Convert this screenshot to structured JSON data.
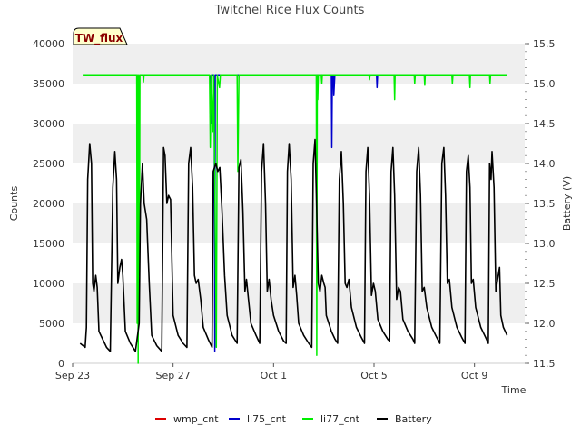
{
  "chart_data": {
    "type": "line",
    "title": "Twitchel Rice Flux Counts",
    "badge": "TW_flux",
    "xlabel": "Time",
    "ylabel": "Counts",
    "y2label": "Battery (V)",
    "xlim": [
      0,
      18
    ],
    "ylim": [
      0,
      40000
    ],
    "y2lim": [
      11.5,
      15.5
    ],
    "x_ticks": [
      {
        "x": 0,
        "label": "Sep 23"
      },
      {
        "x": 4,
        "label": "Sep 27"
      },
      {
        "x": 8,
        "label": "Oct 1"
      },
      {
        "x": 12,
        "label": "Oct 5"
      },
      {
        "x": 16,
        "label": "Oct 9"
      }
    ],
    "y_ticks": [
      0,
      5000,
      10000,
      15000,
      20000,
      25000,
      30000,
      35000,
      40000
    ],
    "y2_ticks": [
      "11.5",
      "12.0",
      "12.5",
      "13.0",
      "13.5",
      "14.0",
      "14.5",
      "15.0",
      "15.5"
    ],
    "grid": "horizontal bands",
    "legend_position": "bottom",
    "series": [
      {
        "name": "wmp_cnt",
        "axis": "left",
        "color": "#dd0000",
        "points": []
      },
      {
        "name": "li75_cnt",
        "axis": "left",
        "color": "#0000cc",
        "points": [
          [
            5.5,
            36000
          ],
          [
            5.52,
            30000
          ],
          [
            5.54,
            36000
          ],
          [
            5.62,
            36000
          ],
          [
            5.64,
            32500
          ],
          [
            5.66,
            1500
          ],
          [
            5.68,
            36000
          ],
          [
            10.3,
            36000
          ],
          [
            10.32,
            27000
          ],
          [
            10.34,
            36000
          ],
          [
            10.38,
            36000
          ],
          [
            10.4,
            33500
          ],
          [
            10.44,
            36000
          ],
          [
            12.1,
            36000
          ],
          [
            12.12,
            34500
          ],
          [
            12.14,
            36000
          ],
          [
            17.3,
            36000
          ]
        ]
      },
      {
        "name": "li77_cnt",
        "axis": "left",
        "color": "#00ee00",
        "points": [
          [
            0.4,
            36000
          ],
          [
            2.55,
            36000
          ],
          [
            2.57,
            5000
          ],
          [
            2.59,
            36000
          ],
          [
            2.61,
            0
          ],
          [
            2.63,
            36000
          ],
          [
            2.66,
            11000
          ],
          [
            2.68,
            36000
          ],
          [
            2.8,
            36000
          ],
          [
            2.82,
            35200
          ],
          [
            2.84,
            36000
          ],
          [
            5.45,
            36000
          ],
          [
            5.48,
            27000
          ],
          [
            5.52,
            36000
          ],
          [
            5.58,
            29000
          ],
          [
            5.62,
            36000
          ],
          [
            5.72,
            2000
          ],
          [
            5.76,
            36000
          ],
          [
            5.85,
            34500
          ],
          [
            5.88,
            36000
          ],
          [
            6.55,
            36000
          ],
          [
            6.58,
            24000
          ],
          [
            6.62,
            36000
          ],
          [
            9.7,
            36000
          ],
          [
            9.72,
            1000
          ],
          [
            9.74,
            36000
          ],
          [
            9.76,
            33000
          ],
          [
            9.78,
            36000
          ],
          [
            9.9,
            36000
          ],
          [
            9.92,
            35000
          ],
          [
            9.94,
            36000
          ],
          [
            11.8,
            36000
          ],
          [
            11.82,
            35500
          ],
          [
            11.84,
            36000
          ],
          [
            12.8,
            36000
          ],
          [
            12.82,
            33000
          ],
          [
            12.84,
            36000
          ],
          [
            13.6,
            36000
          ],
          [
            13.62,
            35000
          ],
          [
            13.64,
            36000
          ],
          [
            14.0,
            36000
          ],
          [
            14.02,
            34800
          ],
          [
            14.04,
            36000
          ],
          [
            15.1,
            36000
          ],
          [
            15.12,
            35000
          ],
          [
            15.14,
            36000
          ],
          [
            15.8,
            36000
          ],
          [
            15.82,
            34500
          ],
          [
            15.84,
            36000
          ],
          [
            16.6,
            36000
          ],
          [
            16.62,
            35000
          ],
          [
            16.64,
            36000
          ],
          [
            17.3,
            36000
          ]
        ]
      },
      {
        "name": "Battery",
        "axis": "right",
        "color": "#000000",
        "points": [
          [
            0.3,
            11.75
          ],
          [
            0.5,
            11.7
          ],
          [
            0.55,
            11.95
          ],
          [
            0.6,
            13.8
          ],
          [
            0.68,
            14.25
          ],
          [
            0.75,
            14.0
          ],
          [
            0.8,
            12.5
          ],
          [
            0.85,
            12.4
          ],
          [
            0.92,
            12.6
          ],
          [
            0.98,
            12.45
          ],
          [
            1.05,
            11.9
          ],
          [
            1.2,
            11.8
          ],
          [
            1.35,
            11.7
          ],
          [
            1.5,
            11.65
          ],
          [
            1.6,
            13.7
          ],
          [
            1.68,
            14.15
          ],
          [
            1.75,
            13.8
          ],
          [
            1.8,
            12.5
          ],
          [
            1.88,
            12.7
          ],
          [
            1.95,
            12.8
          ],
          [
            2.0,
            12.6
          ],
          [
            2.1,
            11.9
          ],
          [
            2.3,
            11.75
          ],
          [
            2.5,
            11.65
          ],
          [
            2.65,
            12.0
          ],
          [
            2.7,
            13.5
          ],
          [
            2.78,
            14.0
          ],
          [
            2.85,
            13.5
          ],
          [
            2.9,
            13.4
          ],
          [
            2.95,
            13.3
          ],
          [
            3.05,
            12.5
          ],
          [
            3.15,
            11.85
          ],
          [
            3.35,
            11.72
          ],
          [
            3.55,
            11.65
          ],
          [
            3.62,
            14.2
          ],
          [
            3.68,
            14.1
          ],
          [
            3.75,
            13.5
          ],
          [
            3.82,
            13.6
          ],
          [
            3.9,
            13.55
          ],
          [
            4.0,
            12.1
          ],
          [
            4.2,
            11.85
          ],
          [
            4.4,
            11.75
          ],
          [
            4.55,
            11.7
          ],
          [
            4.62,
            14.0
          ],
          [
            4.7,
            14.2
          ],
          [
            4.78,
            13.7
          ],
          [
            4.85,
            12.6
          ],
          [
            4.92,
            12.5
          ],
          [
            5.0,
            12.55
          ],
          [
            5.1,
            12.3
          ],
          [
            5.2,
            11.95
          ],
          [
            5.4,
            11.8
          ],
          [
            5.55,
            11.7
          ],
          [
            5.6,
            13.9
          ],
          [
            5.7,
            14.0
          ],
          [
            5.78,
            13.9
          ],
          [
            5.86,
            13.95
          ],
          [
            5.95,
            13.4
          ],
          [
            6.05,
            12.6
          ],
          [
            6.15,
            12.1
          ],
          [
            6.35,
            11.85
          ],
          [
            6.55,
            11.75
          ],
          [
            6.62,
            13.95
          ],
          [
            6.7,
            14.05
          ],
          [
            6.78,
            13.4
          ],
          [
            6.86,
            12.4
          ],
          [
            6.92,
            12.55
          ],
          [
            7.0,
            12.3
          ],
          [
            7.1,
            12.0
          ],
          [
            7.3,
            11.85
          ],
          [
            7.45,
            11.75
          ],
          [
            7.52,
            13.9
          ],
          [
            7.6,
            14.25
          ],
          [
            7.68,
            13.5
          ],
          [
            7.75,
            12.4
          ],
          [
            7.82,
            12.55
          ],
          [
            7.9,
            12.3
          ],
          [
            8.0,
            12.1
          ],
          [
            8.2,
            11.9
          ],
          [
            8.4,
            11.78
          ],
          [
            8.5,
            11.75
          ],
          [
            8.55,
            13.9
          ],
          [
            8.62,
            14.25
          ],
          [
            8.7,
            13.8
          ],
          [
            8.78,
            12.45
          ],
          [
            8.85,
            12.6
          ],
          [
            8.92,
            12.35
          ],
          [
            9.0,
            12.0
          ],
          [
            9.2,
            11.85
          ],
          [
            9.4,
            11.75
          ],
          [
            9.52,
            11.7
          ],
          [
            9.58,
            14.0
          ],
          [
            9.65,
            14.3
          ],
          [
            9.72,
            13.4
          ],
          [
            9.78,
            12.5
          ],
          [
            9.85,
            12.4
          ],
          [
            9.92,
            12.6
          ],
          [
            10.0,
            12.5
          ],
          [
            10.05,
            12.45
          ],
          [
            10.1,
            12.1
          ],
          [
            10.3,
            11.9
          ],
          [
            10.45,
            11.8
          ],
          [
            10.55,
            11.75
          ],
          [
            10.62,
            13.8
          ],
          [
            10.7,
            14.15
          ],
          [
            10.78,
            13.5
          ],
          [
            10.85,
            12.5
          ],
          [
            10.92,
            12.45
          ],
          [
            11.0,
            12.55
          ],
          [
            11.1,
            12.2
          ],
          [
            11.3,
            11.95
          ],
          [
            11.5,
            11.82
          ],
          [
            11.62,
            11.75
          ],
          [
            11.68,
            13.9
          ],
          [
            11.75,
            14.2
          ],
          [
            11.82,
            13.6
          ],
          [
            11.9,
            12.35
          ],
          [
            11.98,
            12.5
          ],
          [
            12.05,
            12.4
          ],
          [
            12.15,
            12.05
          ],
          [
            12.35,
            11.9
          ],
          [
            12.55,
            11.8
          ],
          [
            12.62,
            11.78
          ],
          [
            12.68,
            13.9
          ],
          [
            12.75,
            14.2
          ],
          [
            12.82,
            13.6
          ],
          [
            12.9,
            12.3
          ],
          [
            12.98,
            12.45
          ],
          [
            13.05,
            12.4
          ],
          [
            13.15,
            12.05
          ],
          [
            13.35,
            11.9
          ],
          [
            13.55,
            11.8
          ],
          [
            13.62,
            11.75
          ],
          [
            13.7,
            13.9
          ],
          [
            13.78,
            14.2
          ],
          [
            13.85,
            13.6
          ],
          [
            13.92,
            12.4
          ],
          [
            14.0,
            12.45
          ],
          [
            14.1,
            12.2
          ],
          [
            14.3,
            11.95
          ],
          [
            14.5,
            11.82
          ],
          [
            14.62,
            11.75
          ],
          [
            14.7,
            14.0
          ],
          [
            14.78,
            14.2
          ],
          [
            14.85,
            13.6
          ],
          [
            14.92,
            12.5
          ],
          [
            15.0,
            12.55
          ],
          [
            15.1,
            12.2
          ],
          [
            15.3,
            11.95
          ],
          [
            15.5,
            11.82
          ],
          [
            15.62,
            11.75
          ],
          [
            15.68,
            13.9
          ],
          [
            15.75,
            14.1
          ],
          [
            15.82,
            13.7
          ],
          [
            15.88,
            12.5
          ],
          [
            15.95,
            12.55
          ],
          [
            16.05,
            12.2
          ],
          [
            16.25,
            11.95
          ],
          [
            16.45,
            11.82
          ],
          [
            16.55,
            11.75
          ],
          [
            16.6,
            14.0
          ],
          [
            16.66,
            13.8
          ],
          [
            16.7,
            14.15
          ],
          [
            16.78,
            13.7
          ],
          [
            16.85,
            12.4
          ],
          [
            16.92,
            12.55
          ],
          [
            17.0,
            12.7
          ],
          [
            17.05,
            12.1
          ],
          [
            17.15,
            11.95
          ],
          [
            17.3,
            11.85
          ]
        ]
      }
    ]
  }
}
